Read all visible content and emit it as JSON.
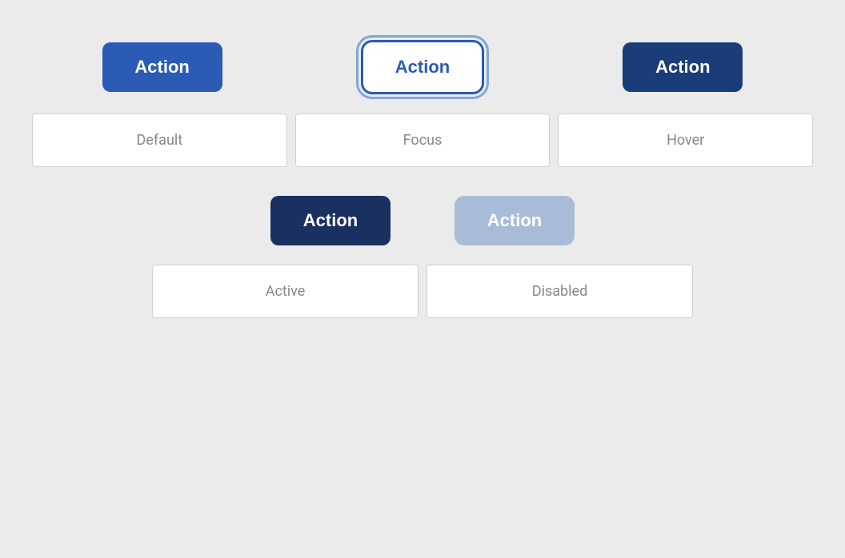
{
  "buttons": {
    "default_label": "Action",
    "focus_label": "Action",
    "hover_label": "Action",
    "active_label": "Action",
    "disabled_label": "Action"
  },
  "state_labels": {
    "default": "Default",
    "focus": "Focus",
    "hover": "Hover",
    "active": "Active",
    "disabled": "Disabled"
  },
  "colors": {
    "default_bg": "#2B5BB5",
    "hover_bg": "#1a3d7a",
    "active_bg": "#1a3060",
    "disabled_bg": "#a8bcd8",
    "focus_border": "#2B5BB5",
    "focus_outline": "#7fa8d8"
  }
}
